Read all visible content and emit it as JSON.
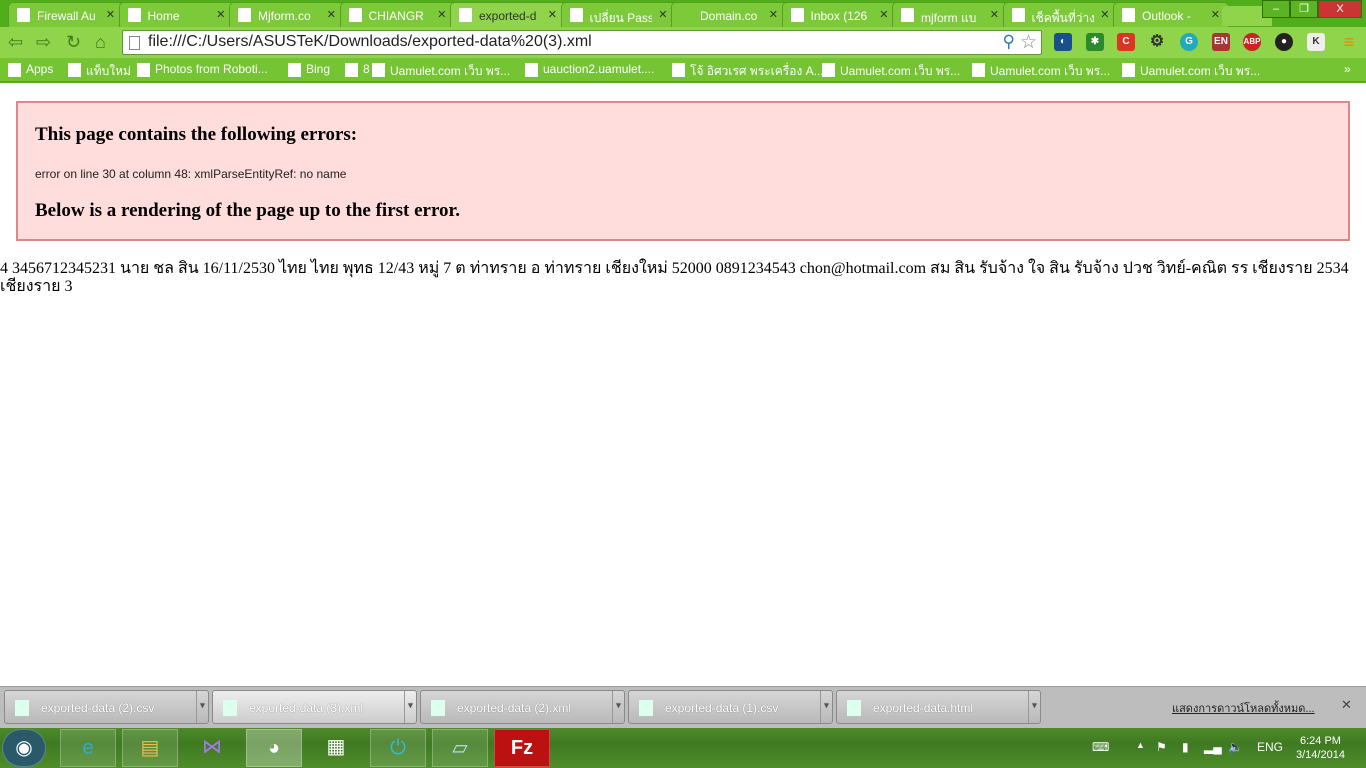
{
  "tabs": [
    {
      "title": "Firewall Au",
      "icon": "page-icon"
    },
    {
      "title": "Home",
      "icon": "flame-icon"
    },
    {
      "title": "Mjform.co",
      "icon": "page-icon"
    },
    {
      "title": "CHIANGR",
      "icon": "joomla-icon"
    },
    {
      "title": "exported-d",
      "icon": "page-icon",
      "active": true
    },
    {
      "title": "เปลี่ยน Pass",
      "icon": "joomla-icon"
    },
    {
      "title": "Domain.co",
      "icon": "none"
    },
    {
      "title": "Inbox (126",
      "icon": "gmail-icon"
    },
    {
      "title": "mjform แบ",
      "icon": "google-icon"
    },
    {
      "title": "เช็คพื้นที่ว่าง",
      "icon": "site-icon"
    },
    {
      "title": "Outlook -",
      "icon": "outlook-icon"
    }
  ],
  "window_controls": {
    "minimize": "–",
    "restore": "❐",
    "close": "X"
  },
  "address": {
    "url": "file:///C:/Users/ASUSTeK/Downloads/exported-data%20(3).xml"
  },
  "bookmarks": [
    {
      "label": "Apps"
    },
    {
      "label": "แท็บใหม่"
    },
    {
      "label": "Photos from Roboti..."
    },
    {
      "label": "Bing"
    },
    {
      "label": "8"
    },
    {
      "label": "Uamulet.com เว็บ พร..."
    },
    {
      "label": "uauction2.uamulet...."
    },
    {
      "label": "โจ้ อิศวเรศ พระเครื่อง A..."
    },
    {
      "label": "Uamulet.com เว็บ พร..."
    },
    {
      "label": "Uamulet.com เว็บ พร..."
    },
    {
      "label": "Uamulet.com เว็บ พร..."
    }
  ],
  "bookmarks_more": "»",
  "error": {
    "heading": "This page contains the following errors:",
    "message": "error on line 30 at column 48: xmlParseEntityRef: no name",
    "footer": "Below is a rendering of the page up to the first error."
  },
  "rendered_text": "4 3456712345231 นาย ชล สิน 16/11/2530 ไทย ไทย พุทธ 12/43 หมู่ 7 ต ท่าทราย อ ท่าทราย เชียงใหม่ 52000 0891234543 chon@hotmail.com สม สิน รับจ้าง ใจ สิน รับจ้าง ปวช วิทย์-คณิต รร เชียงราย 2534 เชียงราย 3",
  "downloads": [
    {
      "name": "exported-data (2).csv",
      "icon": "excel-icon"
    },
    {
      "name": "exported-data (3).xml",
      "icon": "notepad-icon",
      "selected": true
    },
    {
      "name": "exported-data (2).xml",
      "icon": "notepad-icon"
    },
    {
      "name": "exported-data (1).csv",
      "icon": "excel-icon"
    },
    {
      "name": "exported-data.html",
      "icon": "chrome-icon"
    }
  ],
  "show_all_downloads": "แสดงการดาวน์โหลดทั้งหมด...",
  "tray": {
    "lang": "ENG",
    "time": "6:24 PM",
    "date": "3/14/2014"
  },
  "colors": {
    "chrome_theme": "#8fd44a",
    "error_bg": "#ffdddd",
    "error_border": "#dd8888"
  }
}
